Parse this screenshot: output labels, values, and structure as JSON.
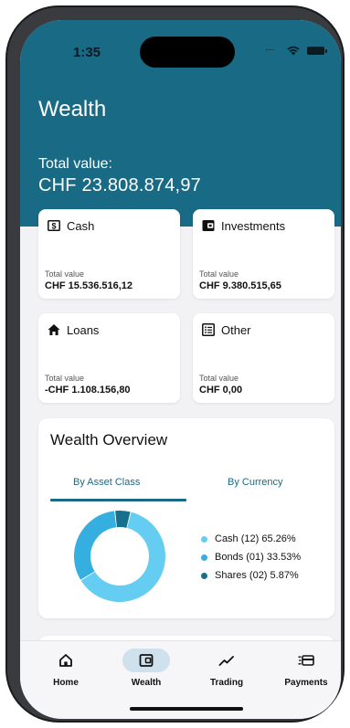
{
  "status_bar": {
    "time": "1:35"
  },
  "header": {
    "title": "Wealth",
    "total_label": "Total value:",
    "total_value": "CHF 23.808.874,97"
  },
  "cards": [
    {
      "label": "Cash",
      "icon": "dollar-bill-icon",
      "sub": "Total value",
      "value": "CHF 15.536.516,12"
    },
    {
      "label": "Investments",
      "icon": "wallet-icon",
      "sub": "Total value",
      "value": "CHF 9.380.515,65"
    },
    {
      "label": "Loans",
      "icon": "home-icon",
      "sub": "Total value",
      "value": "-CHF 1.108.156,80"
    },
    {
      "label": "Other",
      "icon": "list-icon",
      "sub": "Total value",
      "value": "CHF 0,00"
    }
  ],
  "overview": {
    "title": "Wealth Overview",
    "tabs": [
      {
        "label": "By Asset Class",
        "active": true
      },
      {
        "label": "By Currency",
        "active": false
      }
    ],
    "legend": [
      {
        "label": "Cash (12) 65.26%",
        "percent": 65.26,
        "color": "#66cdf2"
      },
      {
        "label": "Bonds (01) 33.53%",
        "percent": 33.53,
        "color": "#35aee0"
      },
      {
        "label": "Shares (02) 5.87%",
        "percent": 5.87,
        "color": "#166f8c"
      }
    ]
  },
  "nav": [
    {
      "label": "Home",
      "icon": "home-outline-icon",
      "active": false
    },
    {
      "label": "Wealth",
      "icon": "wallet-icon",
      "active": true
    },
    {
      "label": "Trading",
      "icon": "trend-icon",
      "active": false
    },
    {
      "label": "Payments",
      "icon": "payments-icon",
      "active": false
    }
  ],
  "colors": {
    "header": "#186a85",
    "accent": "#186a85",
    "nav_active": "#cfe1ec"
  }
}
